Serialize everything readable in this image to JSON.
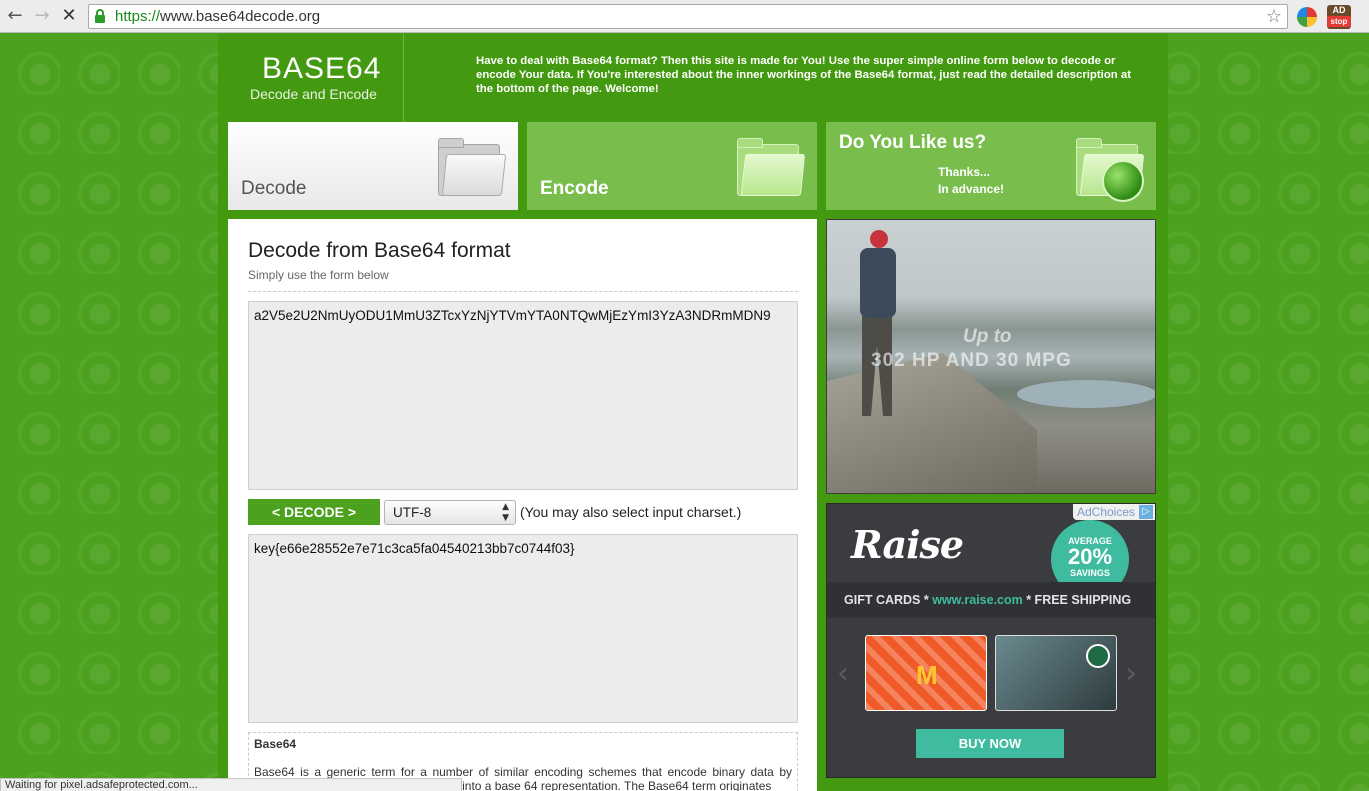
{
  "browser": {
    "url_scheme": "https://",
    "url_rest": "www.base64decode.org",
    "back_icon": "←",
    "forward_icon": "→",
    "stop_icon": "✕",
    "star_icon": "☆",
    "ext2_top": "AD",
    "ext2_bottom": "stop"
  },
  "header": {
    "logo_title": "BASE64",
    "logo_subtitle": "Decode and Encode",
    "intro": "Have to deal with Base64 format? Then this site is made for You! Use the super simple online form below to decode or encode Your data. If You're interested about the inner workings of the Base64 format, just read the detailed description at the bottom of the page. Welcome!"
  },
  "tabs": {
    "decode": "Decode",
    "encode": "Encode",
    "like_title": "Do You Like us?",
    "like_line1": "Thanks...",
    "like_line2": "In advance!"
  },
  "main": {
    "title": "Decode from Base64 format",
    "subtitle": "Simply use the form below",
    "input_value": "a2V5e2U2NmUyODU1MmU3ZTcxYzNjYTVmYTA0NTQwMjEzYmI3YzA3NDRmMDN9",
    "decode_button": "< DECODE >",
    "charset_selected": "UTF-8",
    "charset_hint": "(You may also select input charset.)",
    "output_value": "key{e66e28552e7e71c3ca5fa04540213bb7c0744f03}",
    "info_title": "Base64",
    "info_text": "Base64 is a generic term for a number of similar encoding schemes that encode binary data by treating it numerically and translating it into a base 64 representation. The Base64 term originates"
  },
  "ads": {
    "ad1_line1": "Up to",
    "ad1_line2": "302 HP AND 30 MPG",
    "adchoices": "AdChoices",
    "raise_logo": "Raise",
    "badge_top": "AVERAGE",
    "badge_value": "20%",
    "badge_bottom": "SAVINGS",
    "strip_left": "GIFT CARDS * ",
    "strip_site": "www.raise.com",
    "strip_right": " * FREE SHIPPING",
    "card1_logo": "M",
    "prev_arrow": "‹",
    "next_arrow": "›",
    "buy_button": "BUY NOW"
  },
  "status": {
    "text": "Waiting for pixel.adsafeprotected.com..."
  },
  "colors": {
    "page_green": "#4ca11e",
    "tab_green": "#79bd4d",
    "raise_teal": "#3fbca0"
  }
}
